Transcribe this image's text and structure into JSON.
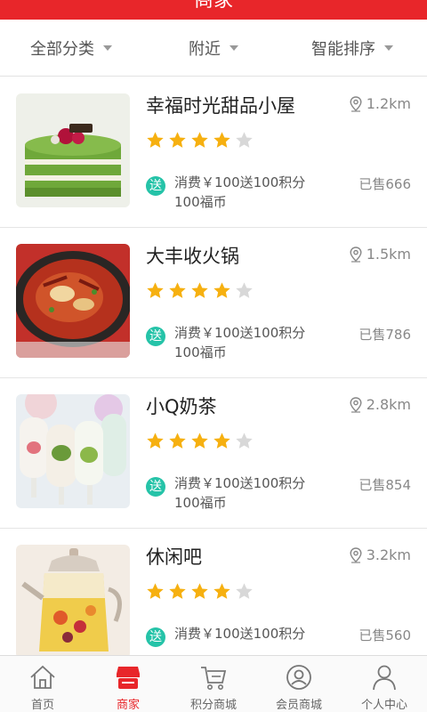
{
  "header": {
    "title": "商家"
  },
  "filters": [
    {
      "label": "全部分类"
    },
    {
      "label": "附近"
    },
    {
      "label": "智能排序"
    }
  ],
  "shops": [
    {
      "name": "幸福时光甜品小屋",
      "distance": "1.2km",
      "rating": 4,
      "promo_badge": "送",
      "promo": "消费￥100送100积分100福币",
      "sold": "已售666",
      "image": "matcha-cake"
    },
    {
      "name": " 大丰收火锅",
      "distance": "1.5km",
      "rating": 4,
      "promo_badge": "送",
      "promo": "消费￥100送100积分100福币",
      "sold": "已售786",
      "image": "hotpot"
    },
    {
      "name": "小Q奶茶",
      "distance": "2.8km",
      "rating": 4,
      "promo_badge": "送",
      "promo": "消费￥100送100积分100福币",
      "sold": "已售854",
      "image": "popsicles"
    },
    {
      "name": "休闲吧",
      "distance": "3.2km",
      "rating": 4,
      "promo_badge": "送",
      "promo": "消费￥100送100积分",
      "sold": "已售560",
      "image": "fruit-tea-pot"
    }
  ],
  "tabbar": [
    {
      "label": "首页",
      "icon": "home-icon",
      "active": false
    },
    {
      "label": "商家",
      "icon": "shop-icon",
      "active": true
    },
    {
      "label": "积分商城",
      "icon": "cart-icon",
      "active": false
    },
    {
      "label": "会员商城",
      "icon": "member-icon",
      "active": false
    },
    {
      "label": "个人中心",
      "icon": "user-icon",
      "active": false
    }
  ],
  "colors": {
    "accent": "#e8262a",
    "star": "#f6b010",
    "star_empty": "#d8d8d8",
    "badge": "#25c3a8"
  }
}
